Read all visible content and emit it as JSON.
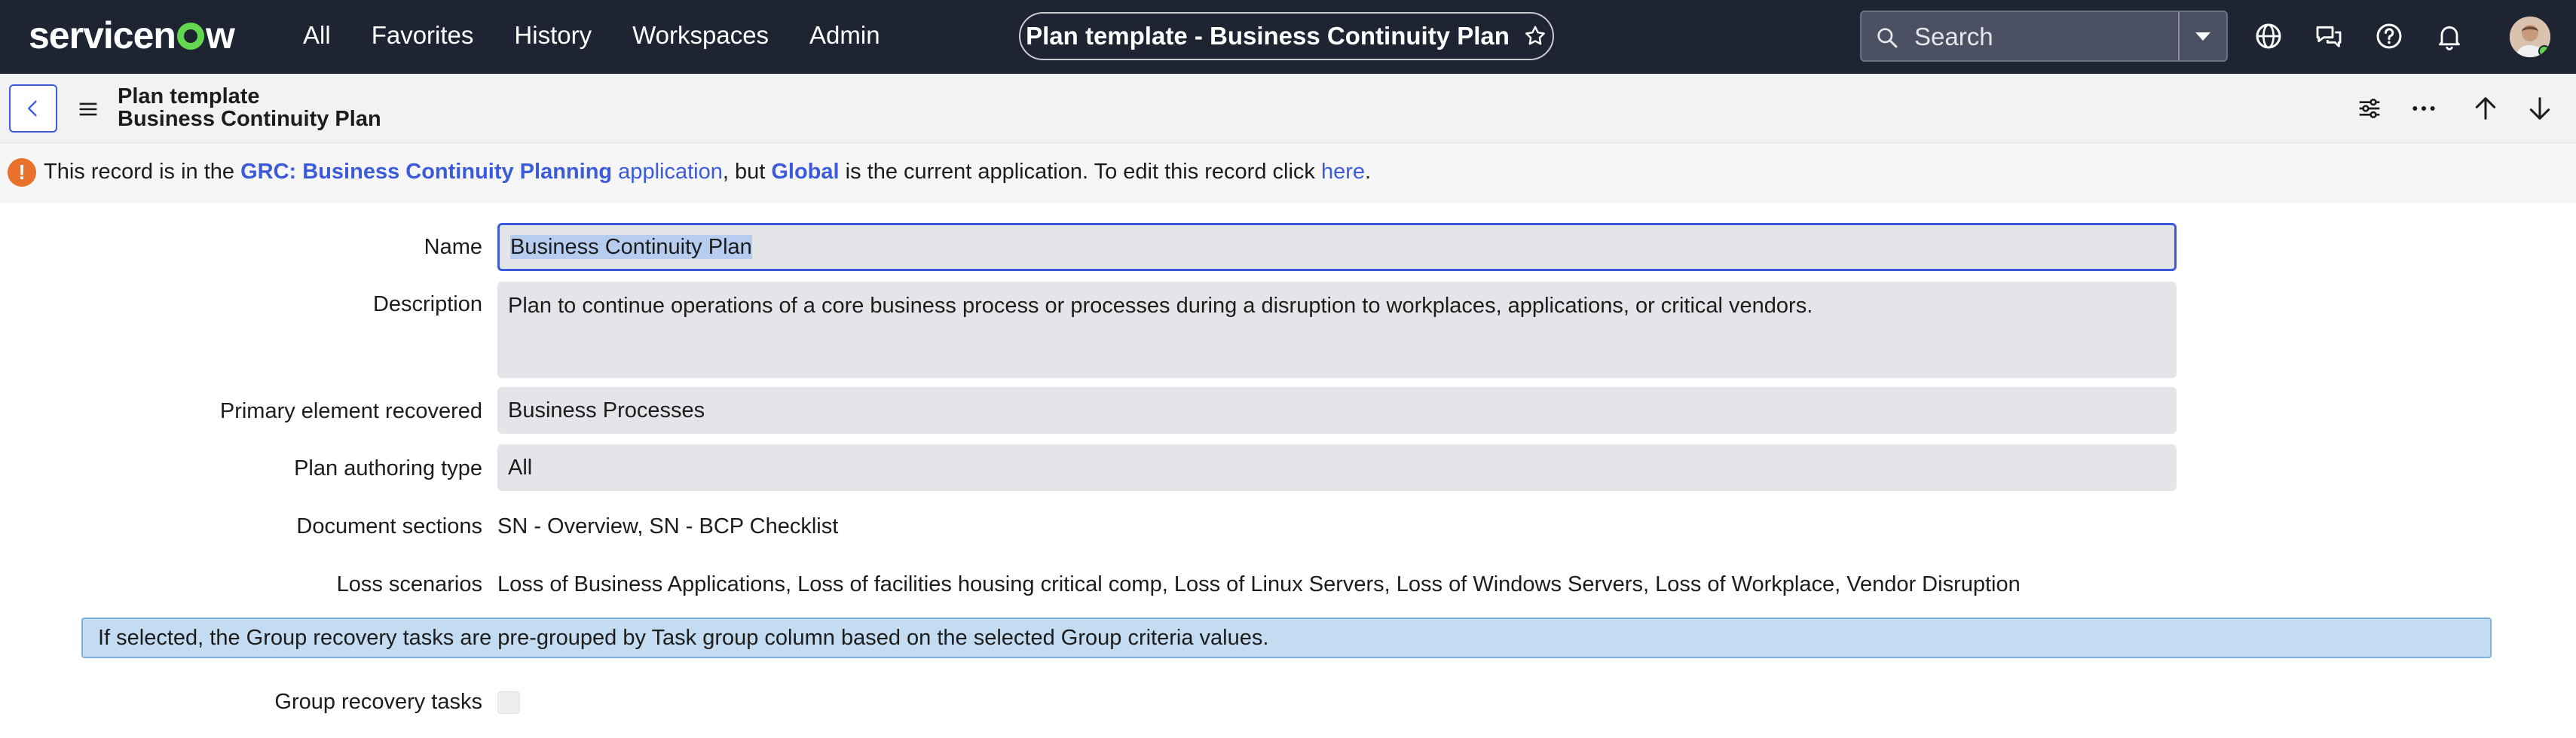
{
  "nav": {
    "logo": "servicenow",
    "items": [
      "All",
      "Favorites",
      "History",
      "Workspaces",
      "Admin"
    ],
    "title_pill": "Plan template - Business Continuity Plan",
    "search_placeholder": "Search"
  },
  "record_header": {
    "type": "Plan template",
    "name": "Business Continuity Plan"
  },
  "info": {
    "prefix": "This record is in the ",
    "app_name": "GRC: Business Continuity Planning",
    "app_word": " application",
    "mid": ", but ",
    "current_app": "Global",
    "suffix": " is the current application. To edit this record click ",
    "link": "here",
    "end": "."
  },
  "form": {
    "name_label": "Name",
    "name_value": "Business Continuity Plan",
    "description_label": "Description",
    "description_value": "Plan to continue operations of a core business process or processes during a disruption to workplaces, applications, or critical vendors.",
    "primary_label": "Primary element recovered",
    "primary_value": "Business Processes",
    "authoring_label": "Plan authoring type",
    "authoring_value": "All",
    "sections_label": "Document sections",
    "sections_value": "SN - Overview, SN - BCP Checklist",
    "loss_label": "Loss scenarios",
    "loss_value": "Loss of Business Applications, Loss of facilities housing critical comp, Loss of Linux Servers, Loss of Windows Servers, Loss of Workplace, Vendor Disruption",
    "hint": "If selected, the Group recovery tasks are pre-grouped by Task group column based on the selected Group criteria values.",
    "group_label": "Group recovery tasks",
    "group_checked": false
  },
  "colors": {
    "nav_bg": "#1e2432",
    "accent": "#3b5bdb",
    "logo_green": "#62d84e",
    "warning": "#e8722c",
    "hint_bg": "#c3dcf2"
  }
}
